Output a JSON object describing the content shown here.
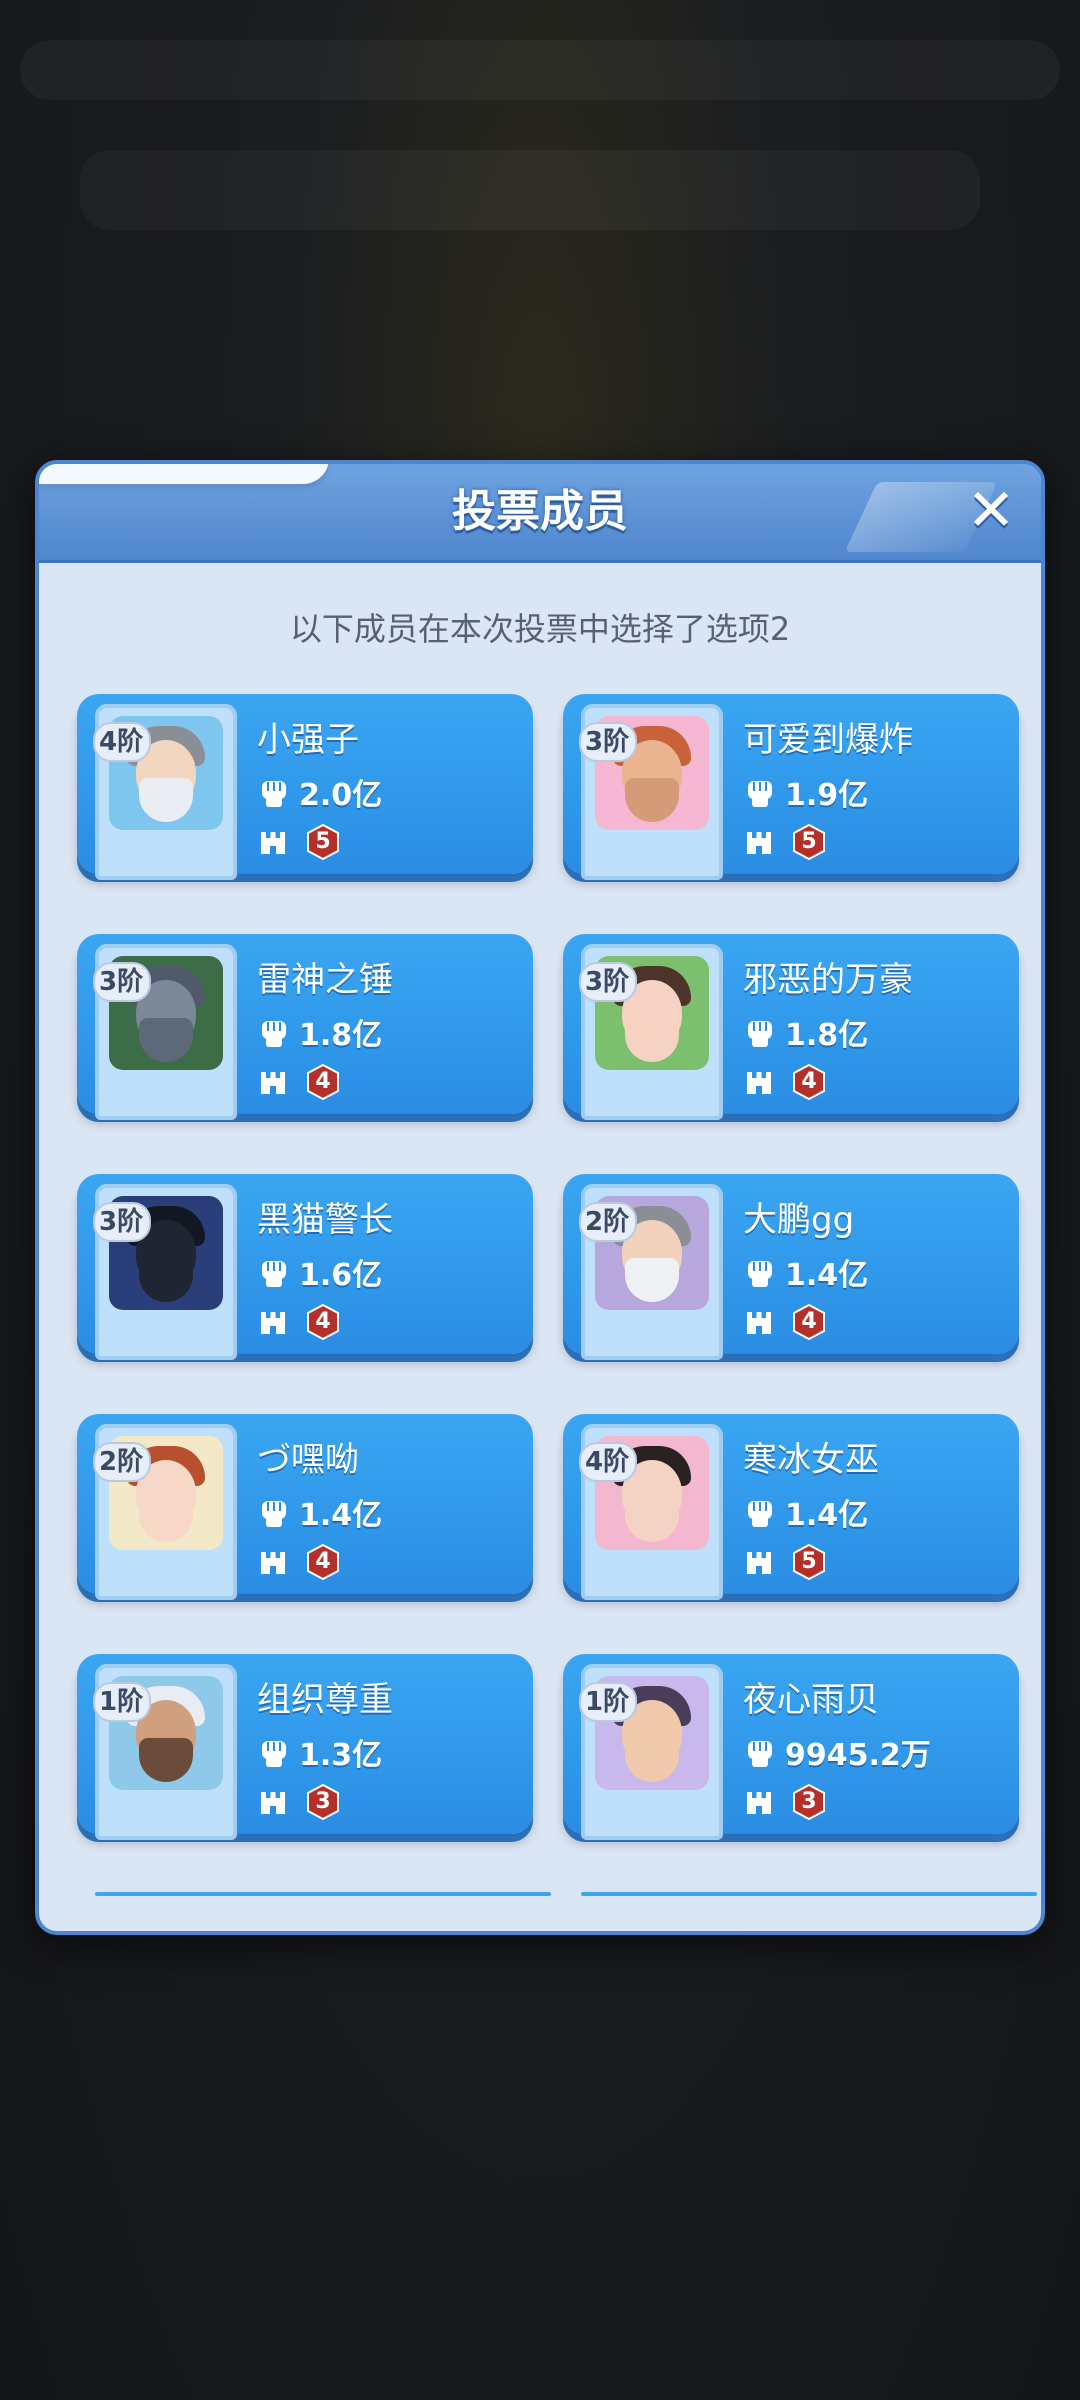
{
  "dialog": {
    "title": "投票成员",
    "close_label": "✕",
    "subtitle": "以下成员在本次投票中选择了选项2"
  },
  "members": [
    {
      "name": "小强子",
      "power": "2.0亿",
      "rank": "4阶",
      "level": "5",
      "skin": "#f3d6bf",
      "hair": "#8a8f96",
      "beard": "#eaeef2",
      "bg": "#7fc6ef"
    },
    {
      "name": "可爱到爆炸",
      "power": "1.9亿",
      "rank": "3阶",
      "level": "5",
      "skin": "#e9b48f",
      "hair": "#c9623a",
      "beard": "#d59a78",
      "bg": "#f5b7d2"
    },
    {
      "name": "雷神之锤",
      "power": "1.8亿",
      "rank": "3阶",
      "level": "4",
      "skin": "#7c8797",
      "hair": "#4f5a6a",
      "beard": "#5d6878",
      "bg": "#3d6d47"
    },
    {
      "name": "邪恶的万豪",
      "power": "1.8亿",
      "rank": "3阶",
      "level": "4",
      "skin": "#f6d2c2",
      "hair": "#4c3528",
      "beard": "#f6d2c2",
      "bg": "#7cc06f"
    },
    {
      "name": "黑猫警长",
      "power": "1.6亿",
      "rank": "3阶",
      "level": "4",
      "skin": "#1f2533",
      "hair": "#121722",
      "beard": "#1f2533",
      "bg": "#2a3f7a"
    },
    {
      "name": "大鹏gg",
      "power": "1.4亿",
      "rank": "2阶",
      "level": "4",
      "skin": "#f1d1bb",
      "hair": "#8a8f96",
      "beard": "#eef1f4",
      "bg": "#b8a7dd"
    },
    {
      "name": "づ嘿呦",
      "power": "1.4亿",
      "rank": "2阶",
      "level": "4",
      "skin": "#f6d7c8",
      "hair": "#b84f2f",
      "beard": "#f6d7c8",
      "bg": "#f3e9c9"
    },
    {
      "name": "寒冰女巫",
      "power": "1.4亿",
      "rank": "4阶",
      "level": "5",
      "skin": "#f5d3c4",
      "hair": "#2a2220",
      "beard": "#f5d3c4",
      "bg": "#f3b8cf"
    },
    {
      "name": "组织尊重",
      "power": "1.3亿",
      "rank": "1阶",
      "level": "3",
      "skin": "#d0a07e",
      "hair": "#e9ecf2",
      "beard": "#6b4b3a",
      "bg": "#8ec9ea"
    },
    {
      "name": "夜心雨贝",
      "power": "9945.2万",
      "rank": "1阶",
      "level": "3",
      "skin": "#f0c9ad",
      "hair": "#4a3d5a",
      "beard": "#f0c9ad",
      "bg": "#c9b8ec"
    }
  ],
  "colors": {
    "level_badge": "#b5302a",
    "card": "#2a8de3",
    "header": "#5b91d8"
  },
  "icons": {
    "power": "fist-icon",
    "castle": "castle-icon",
    "close": "close-icon"
  }
}
